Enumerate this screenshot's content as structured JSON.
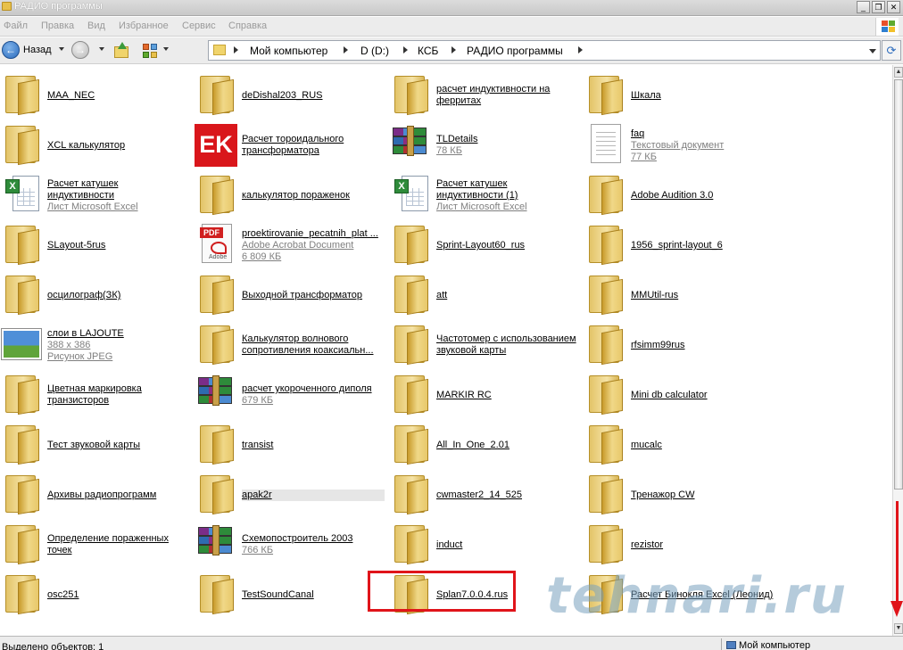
{
  "window": {
    "title": "РАДИО программы",
    "buttons": [
      "_",
      "❐",
      "✕"
    ]
  },
  "menu": [
    "Файл",
    "Правка",
    "Вид",
    "Избранное",
    "Сервис",
    "Справка"
  ],
  "toolbar": {
    "back_label": "Назад"
  },
  "address": {
    "crumbs": [
      "Мой компьютер",
      "D (D:)",
      "КСБ",
      "РАДИО программы"
    ]
  },
  "items": [
    {
      "icon": "folder-icon",
      "name": "MAA_NEC"
    },
    {
      "icon": "folder-icon",
      "name": "deDishal203_RUS"
    },
    {
      "icon": "folder-icon",
      "name": "расчет индуктивности на",
      "name2": "ферритах"
    },
    {
      "icon": "folder-icon",
      "name": "Шкала"
    },
    {
      "icon": "folder-icon",
      "name": "XCL калькулятор"
    },
    {
      "icon": "ek-icon",
      "name": "Расчет тороидального",
      "name2": "трансформатора"
    },
    {
      "icon": "rar-icon",
      "name": "TLDetails",
      "sub1": "78 КБ"
    },
    {
      "icon": "text-document-icon",
      "name": "faq",
      "sub1": "Текстовый документ",
      "sub2": "77 КБ"
    },
    {
      "icon": "excel-icon",
      "name": "Расчет катушек",
      "name2": "индуктивности",
      "sub1": "Лист Microsoft Excel"
    },
    {
      "icon": "folder-icon",
      "name": "калькулятор пораженок"
    },
    {
      "icon": "excel-icon",
      "name": "Расчет катушек",
      "name2": "индуктивности (1)",
      "sub1": "Лист Microsoft Excel"
    },
    {
      "icon": "folder-icon",
      "name": "Adobe Audition 3.0"
    },
    {
      "icon": "folder-icon",
      "name": "SLayout-5rus"
    },
    {
      "icon": "pdf-icon",
      "name": "proektirovanie_pecatnih_plat ...",
      "sub1": "Adobe Acrobat Document",
      "sub2": "6 809 КБ"
    },
    {
      "icon": "folder-icon",
      "name": "Sprint-Layout60_rus"
    },
    {
      "icon": "folder-icon",
      "name": "1956_sprint-layout_6"
    },
    {
      "icon": "folder-icon",
      "name": "осцилограф(ЗК)"
    },
    {
      "icon": "folder-icon",
      "name": "Выходной трансформатор"
    },
    {
      "icon": "folder-icon",
      "name": "att"
    },
    {
      "icon": "folder-icon",
      "name": "MMUtil-rus"
    },
    {
      "icon": "jpeg-image-icon",
      "name": "слои в LAJOUTE",
      "sub1": "388 x 386",
      "sub2": "Рисунок JPEG"
    },
    {
      "icon": "folder-icon",
      "name": "Калькулятор волнового",
      "name2": "сопротивления коаксиальн..."
    },
    {
      "icon": "folder-icon",
      "name": "Частотомер с использованием",
      "name2": "звуковой карты"
    },
    {
      "icon": "folder-icon",
      "name": "rfsimm99rus"
    },
    {
      "icon": "folder-icon",
      "name": "Цветная маркировка",
      "name2": "транзисторов"
    },
    {
      "icon": "rar-icon",
      "name": "расчет укороченного диполя",
      "sub1": "679 КБ"
    },
    {
      "icon": "folder-icon",
      "name": "MARKIR RC"
    },
    {
      "icon": "folder-icon",
      "name": "Mini db calculator"
    },
    {
      "icon": "folder-icon",
      "name": "Тест звуковой карты"
    },
    {
      "icon": "folder-icon",
      "name": "transist"
    },
    {
      "icon": "folder-icon",
      "name": "All_In_One_2.01"
    },
    {
      "icon": "folder-icon",
      "name": "mucalc"
    },
    {
      "icon": "folder-icon",
      "name": "Архивы радиопрограмм"
    },
    {
      "icon": "folder-icon",
      "name": "apak2r",
      "highlight": "true"
    },
    {
      "icon": "folder-icon",
      "name": "cwmaster2_14_525"
    },
    {
      "icon": "folder-icon",
      "name": "Тренажор CW"
    },
    {
      "icon": "folder-icon",
      "name": "Определение пораженных",
      "name2": "точек"
    },
    {
      "icon": "rar-icon",
      "name": "Схемопостроитель 2003",
      "sub1": "766 КБ"
    },
    {
      "icon": "folder-icon",
      "name": "induct"
    },
    {
      "icon": "folder-icon",
      "name": "rezistor"
    },
    {
      "icon": "folder-icon",
      "name": "osc251"
    },
    {
      "icon": "folder-icon",
      "name": "TestSoundCanal"
    },
    {
      "icon": "folder-icon",
      "name": "Splan7.0.0.4.rus"
    },
    {
      "icon": "folder-icon",
      "name": "Расчет Бинокля Excel (Леонид)"
    }
  ],
  "watermark": "tehnari.ru",
  "status": {
    "left": "Выделено объектов: 1",
    "right": "Мой компьютер"
  },
  "colors": {
    "highlight_box": "#e0141a",
    "watermark": "#78a0be"
  }
}
